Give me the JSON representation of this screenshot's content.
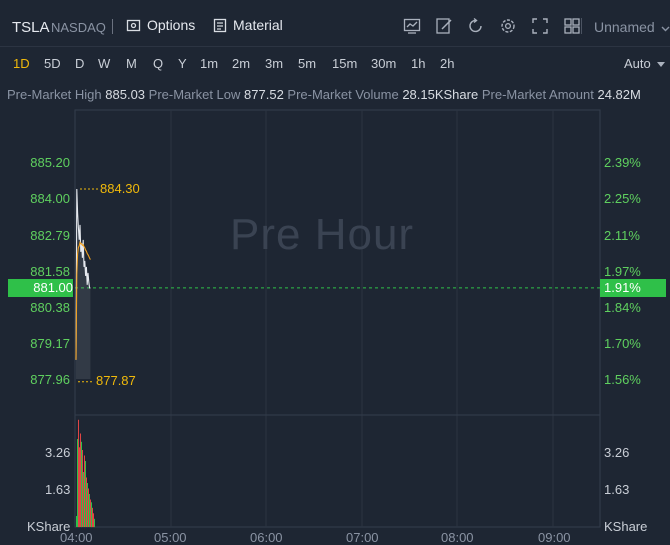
{
  "header": {
    "symbol": "TSLA",
    "exchange": "NASDAQ",
    "options_label": "Options",
    "material_label": "Material",
    "layout_name": "Unnamed"
  },
  "periods": [
    "1D",
    "5D",
    "D",
    "W",
    "M",
    "Q",
    "Y",
    "1m",
    "2m",
    "3m",
    "5m",
    "15m",
    "30m",
    "1h",
    "2h"
  ],
  "active_period": "1D",
  "scale_mode": "Auto",
  "stats": {
    "high_label": "Pre-Market High",
    "high_value": "885.03",
    "low_label": "Pre-Market Low",
    "low_value": "877.52",
    "volume_label": "Pre-Market Volume",
    "volume_value": "28.15KShare",
    "amount_label": "Pre-Market Amount",
    "amount_value": "24.82M"
  },
  "watermark": "Pre Hour",
  "price_axis": [
    "885.20",
    "884.00",
    "882.79",
    "881.58",
    "880.38",
    "879.17",
    "877.96"
  ],
  "percent_axis": [
    "2.39%",
    "2.25%",
    "2.11%",
    "1.97%",
    "1.84%",
    "1.70%",
    "1.56%"
  ],
  "current_price": "881.00",
  "current_percent": "1.91%",
  "high_marker": "884.30",
  "low_marker": "877.87",
  "volume_axis": [
    "3.26",
    "1.63"
  ],
  "volume_unit": "KShare",
  "time_axis": [
    "04:00",
    "05:00",
    "06:00",
    "07:00",
    "08:00",
    "09:00"
  ],
  "colors": {
    "up": "#2fc049",
    "down": "#e04545",
    "accent": "#f0b90b",
    "background": "#1e2633"
  },
  "chart_data": {
    "type": "line",
    "x": [
      "04:00",
      "04:01",
      "04:02",
      "04:03",
      "04:04",
      "04:05",
      "04:06",
      "04:07",
      "04:08",
      "04:09",
      "04:10",
      "04:11",
      "04:12",
      "04:13",
      "04:14",
      "04:15",
      "04:16",
      "04:17",
      "04:18"
    ],
    "series": [
      {
        "values": [
          878.6,
          884.3,
          883.5,
          883.0,
          882.6,
          883.1,
          882.2,
          882.5,
          882.0,
          882.6,
          881.7,
          881.9,
          881.4,
          881.7,
          881.1,
          881.5,
          881.2,
          881.0,
          881.0
        ]
      }
    ],
    "volume": [
      0.4,
      3.2,
      3.9,
      2.9,
      3.4,
      3.1,
      2.8,
      2.0,
      2.6,
      2.4,
      1.8,
      1.6,
      1.4,
      1.2,
      1.0,
      0.9,
      0.7,
      0.5,
      0.3
    ],
    "ylim": [
      877.5,
      886.0
    ]
  }
}
